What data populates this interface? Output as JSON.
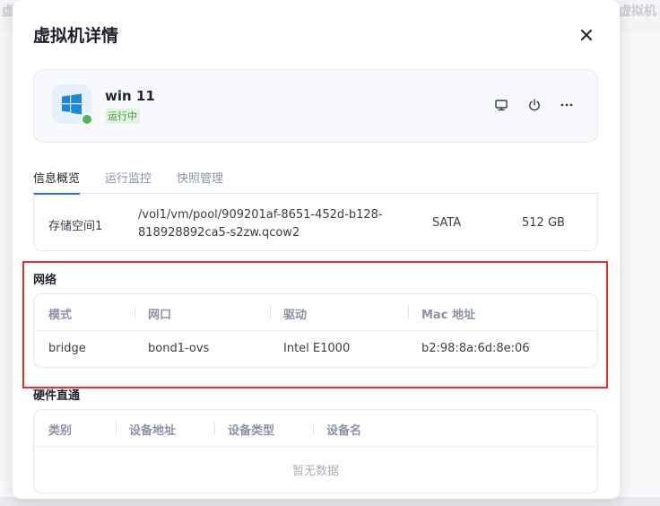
{
  "backdrop": {
    "left_text": "虚",
    "right_text": "虚拟机"
  },
  "modal": {
    "title": "虚拟机详情"
  },
  "vm": {
    "name": "win 11",
    "status": "运行中",
    "status_color": "#52b358",
    "actions": [
      "monitor-icon",
      "power-icon",
      "more-icon"
    ]
  },
  "tabs": [
    {
      "label": "信息概览",
      "active": true
    },
    {
      "label": "运行监控",
      "active": false
    },
    {
      "label": "快照管理",
      "active": false
    }
  ],
  "storage": {
    "name": "存储空间1",
    "path_line1": "/vol1/vm/pool/909201af-8651-452d-b128-",
    "path_line2": "818928892ca5-s2zw.qcow2",
    "bus": "SATA",
    "size": "512 GB"
  },
  "network": {
    "title": "网络",
    "columns": [
      "模式",
      "网口",
      "驱动",
      "Mac 地址"
    ],
    "rows": [
      [
        "bridge",
        "bond1-ovs",
        "Intel E1000",
        "b2:98:8a:6d:8e:06"
      ]
    ]
  },
  "hardware": {
    "title": "硬件直通",
    "columns": [
      "类别",
      "设备地址",
      "设备类型",
      "设备名"
    ],
    "empty_text": "暂无数据"
  },
  "colors": {
    "accent": "#2f6fe4",
    "highlight_border": "#e0322d",
    "windows_blue": "#1e88d8"
  }
}
